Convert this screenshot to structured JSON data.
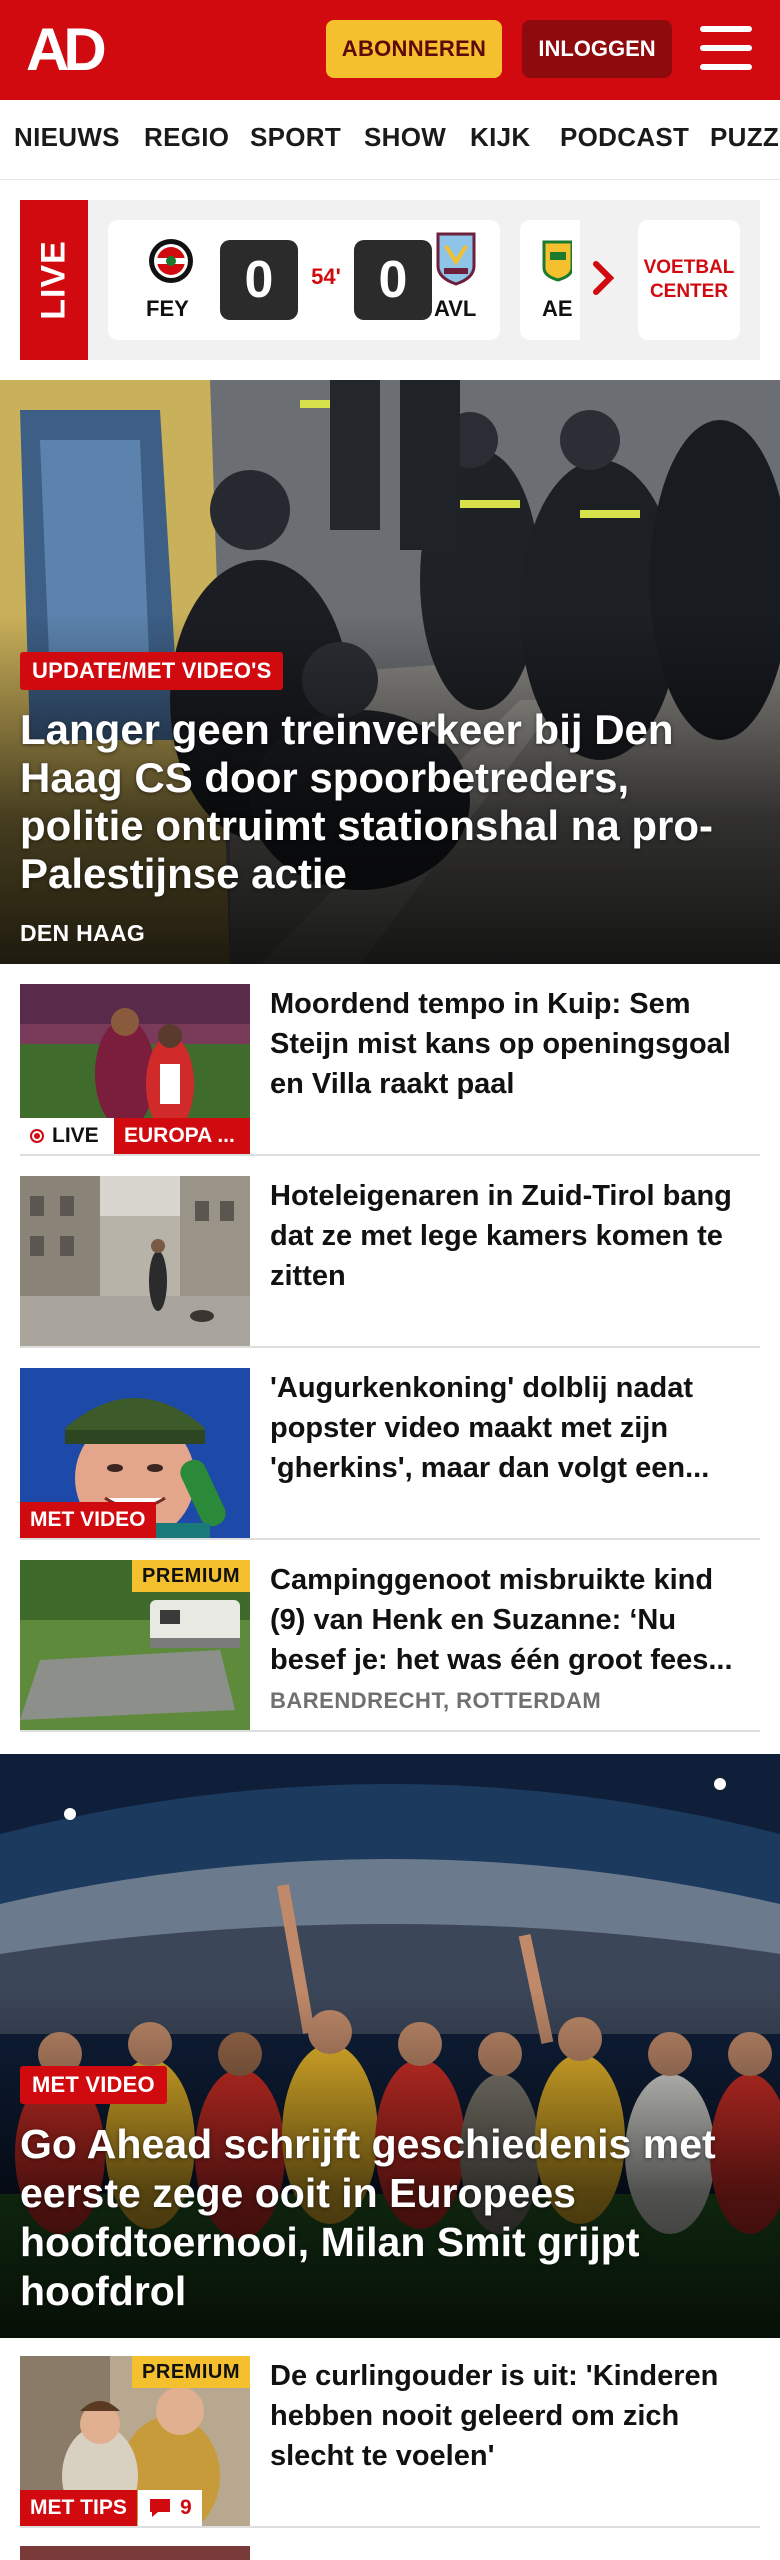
{
  "header": {
    "logo": "AD",
    "subscribe_label": "ABONNEREN",
    "login_label": "INLOGGEN",
    "brand_color": "#d10a10"
  },
  "nav": {
    "items": [
      "NIEUWS",
      "REGIO",
      "SPORT",
      "SHOW",
      "KIJK",
      "PODCAST",
      "PUZZ"
    ]
  },
  "live_scores": {
    "live_label": "LIVE",
    "match": {
      "home_code": "FEY",
      "home_score": "0",
      "minute": "54'",
      "away_score": "0",
      "away_code": "AVL"
    },
    "next_match_code": "AE",
    "voetbal_center_label": "VOETBAL CENTER"
  },
  "hero": {
    "badge": "UPDATE/MET VIDEO'S",
    "title": "Langer geen treinverkeer bij Den Haag CS door spoorbetreders, politie ontruimt stationshal na pro-Palestijnse actie",
    "location": "DEN HAAG"
  },
  "articles": [
    {
      "title": "Moordend tempo in Kuip: Sem Steijn mist kans op openingsgoal en Villa raakt paal",
      "live_label": "LIVE",
      "badge": "EUROPA ..."
    },
    {
      "title": "Hoteleigenaren in Zuid-Tirol bang dat ze met lege kamers komen te zitten"
    },
    {
      "title": "'Augurkenkoning' dolblij nadat popster video maakt met zijn 'gherkins', maar dan volgt een...",
      "badge": "MET VIDEO"
    },
    {
      "title": "Campinggenoot misbruikte kind (9) van Henk en Suzanne: ‘Nu besef je: het was één groot fees...",
      "premium_label": "PREMIUM",
      "meta": "BARENDRECHT, ROTTERDAM"
    }
  ],
  "hero2": {
    "badge": "MET VIDEO",
    "title": "Go Ahead schrijft geschiedenis met eerste zege ooit in Europees hoofdtoernooi, Milan Smit grijpt hoofdrol"
  },
  "articles2": [
    {
      "title": "De curlingouder is uit: 'Kinderen hebben nooit geleerd om zich slecht te voelen'",
      "premium_label": "PREMIUM",
      "badge": "MET TIPS",
      "comments": "9"
    }
  ]
}
